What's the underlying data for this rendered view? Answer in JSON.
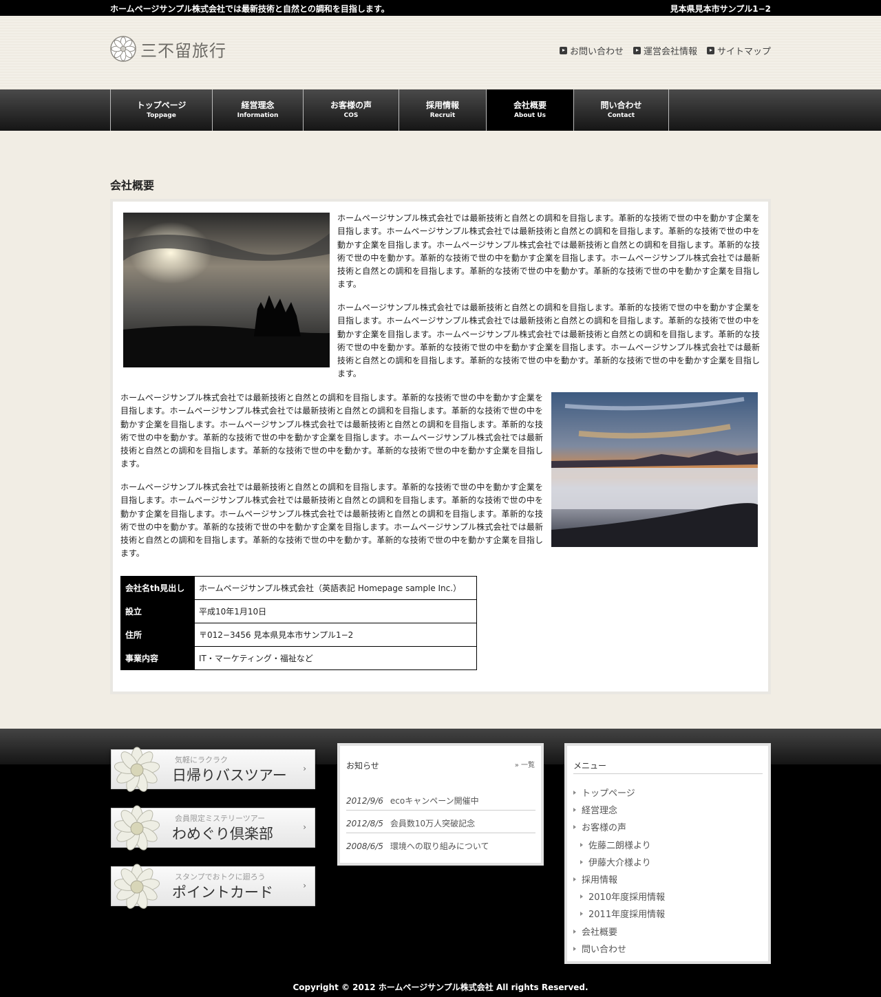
{
  "topbar": {
    "tagline": "ホームページサンプル株式会社では最新技術と自然との調和を目指します。",
    "address": "見本県見本市サンプル1−2"
  },
  "header": {
    "logo_text": "三不留旅行",
    "util_links": [
      "お問い合わせ",
      "運営会社情報",
      "サイトマップ"
    ]
  },
  "nav": {
    "items": [
      {
        "ja": "トップページ",
        "en": "Toppage"
      },
      {
        "ja": "経営理念",
        "en": "Information"
      },
      {
        "ja": "お客様の声",
        "en": "COS"
      },
      {
        "ja": "採用情報",
        "en": "Recruit"
      },
      {
        "ja": "会社概要",
        "en": "About Us"
      },
      {
        "ja": "問い合わせ",
        "en": "Contact"
      }
    ],
    "active": "会社概要"
  },
  "main": {
    "title": "会社概要",
    "paragraphs": [
      "ホームページサンプル株式会社では最新技術と自然との調和を目指します。革新的な技術で世の中を動かす企業を目指します。ホームページサンプル株式会社では最新技術と自然との調和を目指します。革新的な技術で世の中を動かす企業を目指します。ホームページサンプル株式会社では最新技術と自然との調和を目指します。革新的な技術で世の中を動かす。革新的な技術で世の中を動かす企業を目指します。ホームページサンプル株式会社では最新技術と自然との調和を目指します。革新的な技術で世の中を動かす。革新的な技術で世の中を動かす企業を目指します。",
      "ホームページサンプル株式会社では最新技術と自然との調和を目指します。革新的な技術で世の中を動かす企業を目指します。ホームページサンプル株式会社では最新技術と自然との調和を目指します。革新的な技術で世の中を動かす企業を目指します。ホームページサンプル株式会社では最新技術と自然との調和を目指します。革新的な技術で世の中を動かす。革新的な技術で世の中を動かす企業を目指します。ホームページサンプル株式会社では最新技術と自然との調和を目指します。革新的な技術で世の中を動かす。革新的な技術で世の中を動かす企業を目指します。",
      "ホームページサンプル株式会社では最新技術と自然との調和を目指します。革新的な技術で世の中を動かす企業を目指します。ホームページサンプル株式会社では最新技術と自然との調和を目指します。革新的な技術で世の中を動かす企業を目指します。ホームページサンプル株式会社では最新技術と自然との調和を目指します。革新的な技術で世の中を動かす。革新的な技術で世の中を動かす企業を目指します。ホームページサンプル株式会社では最新技術と自然との調和を目指します。革新的な技術で世の中を動かす。革新的な技術で世の中を動かす企業を目指します。",
      "ホームページサンプル株式会社では最新技術と自然との調和を目指します。革新的な技術で世の中を動かす企業を目指します。ホームページサンプル株式会社では最新技術と自然との調和を目指します。革新的な技術で世の中を動かす企業を目指します。ホームページサンプル株式会社では最新技術と自然との調和を目指します。革新的な技術で世の中を動かす。革新的な技術で世の中を動かす企業を目指します。ホームページサンプル株式会社では最新技術と自然との調和を目指します。革新的な技術で世の中を動かす。革新的な技術で世の中を動かす企業を目指します。"
    ],
    "table": [
      {
        "th": "会社名th見出し",
        "td": "ホームページサンプル株式会社（英語表記 Homepage sample Inc.）"
      },
      {
        "th": "設立",
        "td": "平成10年1月10日"
      },
      {
        "th": "住所",
        "td": "〒012−3456 見本県見本市サンプル1−2"
      },
      {
        "th": "事業内容",
        "td": "IT・マーケティング・福祉など"
      }
    ]
  },
  "footer": {
    "banners": [
      {
        "sub": "気軽にラクラク",
        "main": "日帰りバスツアー"
      },
      {
        "sub": "会員限定ミステリーツアー",
        "main": "わめぐり倶楽部"
      },
      {
        "sub": "スタンプでおトクに廻ろう",
        "main": "ポイントカード"
      }
    ],
    "news": {
      "heading": "お知らせ",
      "more": "一覧",
      "items": [
        {
          "date": "2012/9/6",
          "text": "ecoキャンペーン開催中"
        },
        {
          "date": "2012/8/5",
          "text": "会員数10万人突破記念"
        },
        {
          "date": "2008/6/5",
          "text": "環境への取り組みについて"
        }
      ]
    },
    "menu": {
      "heading": "メニュー",
      "items": [
        {
          "label": "トップページ",
          "level": 0
        },
        {
          "label": "経営理念",
          "level": 0
        },
        {
          "label": "お客様の声",
          "level": 0
        },
        {
          "label": "佐藤二朗様より",
          "level": 1
        },
        {
          "label": "伊藤大介様より",
          "level": 1
        },
        {
          "label": "採用情報",
          "level": 0
        },
        {
          "label": "2010年度採用情報",
          "level": 1
        },
        {
          "label": "2011年度採用情報",
          "level": 1
        },
        {
          "label": "会社概要",
          "level": 0
        },
        {
          "label": "問い合わせ",
          "level": 0
        }
      ]
    },
    "copyright": "Copyright © 2012 ホームページサンプル株式会社 All rights Reserved."
  }
}
